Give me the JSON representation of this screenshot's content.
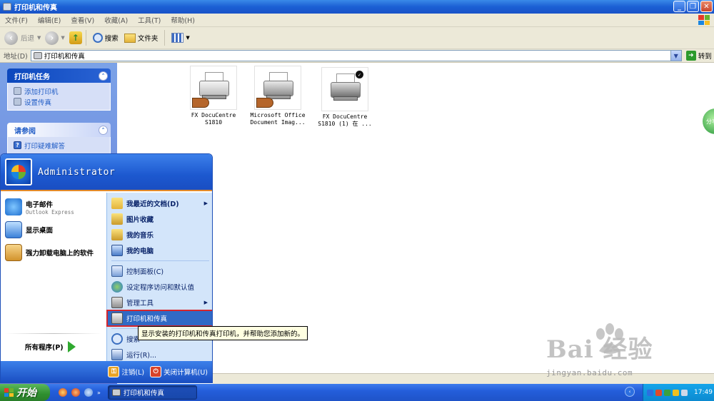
{
  "window": {
    "title": "打印机和传真"
  },
  "menubar": [
    "文件(F)",
    "编辑(E)",
    "查看(V)",
    "收藏(A)",
    "工具(T)",
    "帮助(H)"
  ],
  "toolbar": {
    "back": "后退",
    "search": "搜索",
    "folders": "文件夹"
  },
  "address": {
    "label": "地址(D)",
    "value": "打印机和传真",
    "go": "转到"
  },
  "taskpane": {
    "printer_tasks": {
      "title": "打印机任务",
      "items": [
        "添加打印机",
        "设置传真"
      ]
    },
    "see_also": {
      "title": "请参阅",
      "items": [
        "打印疑难解答"
      ]
    }
  },
  "printers": [
    {
      "name": "FX DocuCentre\nS1810"
    },
    {
      "name": "Microsoft Office\nDocument Imag..."
    },
    {
      "name": "FX DocuCentre\nS1810 (1) 在 ..."
    }
  ],
  "right_bubble": "分享",
  "startmenu": {
    "user": "Administrator",
    "left_items": [
      {
        "label": "电子邮件",
        "sub": "Outlook Express"
      },
      {
        "label": "显示桌面"
      },
      {
        "label": "强力卸载电脑上的软件"
      }
    ],
    "all_programs": "所有程序(P)",
    "right_items": [
      {
        "label": "我最近的文档(D)"
      },
      {
        "label": "图片收藏"
      },
      {
        "label": "我的音乐"
      },
      {
        "label": "我的电脑"
      },
      {
        "label": "控制面板(C)"
      },
      {
        "label": "设定程序访问和默认值"
      },
      {
        "label": "管理工具"
      },
      {
        "label": "打印机和传真"
      },
      {
        "label": "搜索"
      },
      {
        "label": "运行(R)..."
      }
    ],
    "logoff": "注销(L)",
    "shutdown": "关闭计算机(U)"
  },
  "tooltip": "显示安装的打印机和传真打印机，并帮助您添加新的。",
  "taskbar": {
    "start": "开始",
    "task": "打印机和传真",
    "clock": "17:49"
  },
  "watermark": {
    "brand": "Bai 经验",
    "url": "jingyan.baidu.com"
  },
  "colors": {
    "xp_blue": "#245edb",
    "highlight": "#316ac5",
    "tooltip_bg": "#ffffe1",
    "accent_red": "#d6262c"
  }
}
